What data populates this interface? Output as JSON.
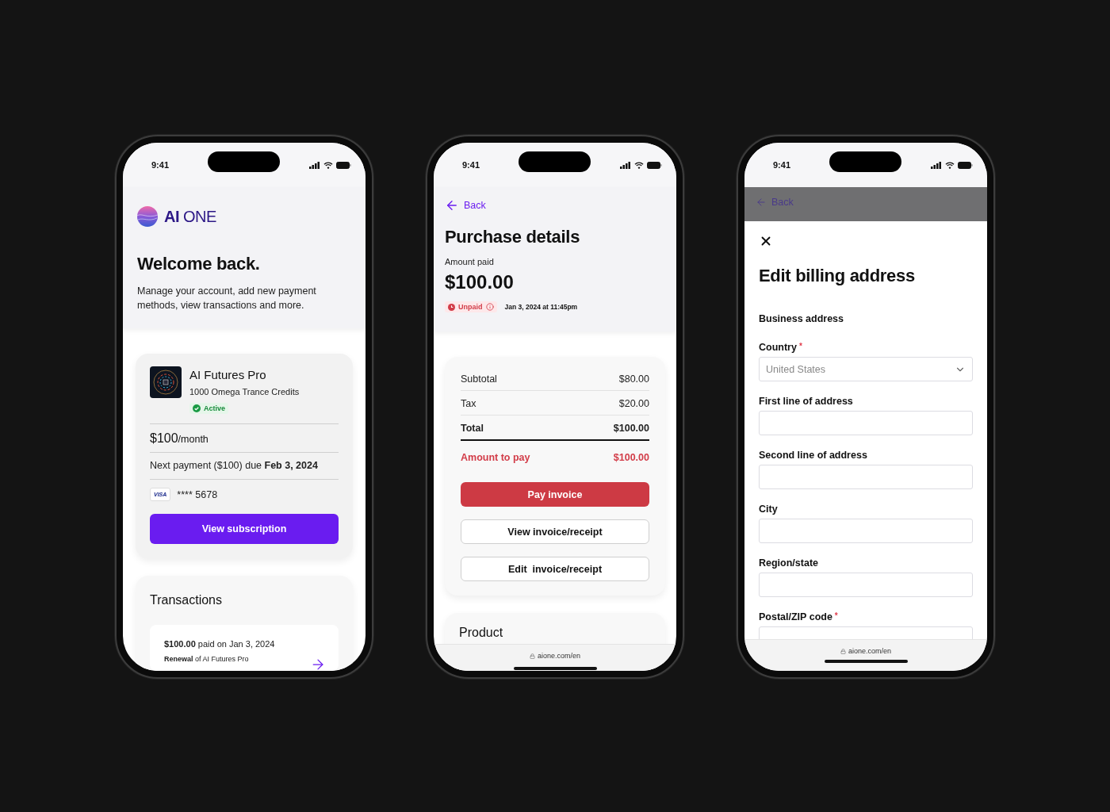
{
  "phones": [
    {
      "kind": "account",
      "status_bar": {
        "time": "9:41"
      },
      "logo": "**AI** ONE",
      "heading": "Welcome back.",
      "intro": "Manage your account, add new payment methods, view transactions and more.",
      "subscription": {
        "name": "AI Futures Pro",
        "credits": "1000 Omega Trance Credits",
        "status": "Active",
        "price": "$100",
        "period": "/month",
        "next_payment": "Next payment ($100) due **Feb 3, 2024**",
        "card_brand": "VISA",
        "card_number": "**** 5678",
        "button": "View subscription"
      },
      "transactions": {
        "title": "Transactions",
        "items": [
          {
            "summary": "**$100.00** paid on Jan 3, 2024",
            "detail": "**Renewal** of AI Futures Pro"
          }
        ]
      }
    },
    {
      "kind": "purchase",
      "status_bar": {
        "time": "9:41"
      },
      "back": "Back",
      "heading": "Purchase details",
      "amount_label": "Amount paid",
      "amount": "$100.00",
      "status": "Unpaid",
      "date": "Jan 3, 2024 at 11:45pm",
      "lines": [
        {
          "label": "Subtotal",
          "value": "$80.00",
          "kind": "plain"
        },
        {
          "label": "Tax",
          "value": "$20.00",
          "kind": "plain"
        },
        {
          "label": "Total",
          "value": "$100.00",
          "kind": "total"
        },
        {
          "label": "Amount to pay",
          "value": "$100.00",
          "kind": "due"
        }
      ],
      "buttons": [
        {
          "label": "Pay invoice",
          "kind": "primary"
        },
        {
          "label": "View invoice/receipt",
          "kind": "outline"
        },
        {
          "label": "Edit  invoice/receipt",
          "kind": "outline"
        }
      ],
      "section_title": "Product",
      "url": "aione.com/en"
    },
    {
      "kind": "billing",
      "status_bar": {
        "time": "9:41"
      },
      "back": "Back",
      "heading": "Edit billing address",
      "subheading": "Business address",
      "fields": [
        {
          "label": "Country",
          "required_mark": "*",
          "kind": "select",
          "placeholder": "United States"
        },
        {
          "label": "First line of address",
          "kind": "text"
        },
        {
          "label": "Second line of address",
          "kind": "text"
        },
        {
          "label": "City",
          "kind": "text"
        },
        {
          "label": "Region/state",
          "kind": "text"
        },
        {
          "label": "Postal/ZIP code",
          "required_mark": "*",
          "kind": "text"
        }
      ],
      "url": "aione.com/en"
    }
  ]
}
